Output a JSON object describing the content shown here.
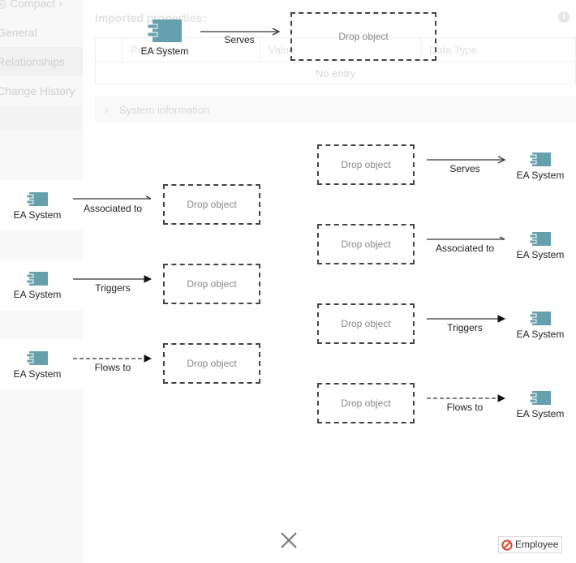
{
  "background": {
    "sidebar": {
      "compact_label": "Compact",
      "items": [
        {
          "label": "General"
        },
        {
          "label": "Relationships"
        },
        {
          "label": "Change History"
        }
      ]
    },
    "imported_properties": {
      "title": "Imported properties:",
      "columns": [
        "Property",
        "Value",
        "Data Type"
      ],
      "empty_text": "No entry"
    },
    "system_information_label": "System information",
    "info_icon": "info-icon"
  },
  "diagram": {
    "top": {
      "source": {
        "label": "EA System",
        "icon": "application-component-icon"
      },
      "relation": "Serves",
      "target": {
        "label": "Drop object"
      }
    },
    "incoming": [
      {
        "source": "Drop object",
        "relation": "Serves",
        "target": "EA System",
        "line": "solid",
        "head": "open"
      },
      {
        "source": "Drop object",
        "relation": "Associated to",
        "target": "EA System",
        "line": "solid",
        "head": "half"
      },
      {
        "source": "Drop object",
        "relation": "Triggers",
        "target": "EA System",
        "line": "solid",
        "head": "filled"
      },
      {
        "source": "Drop object",
        "relation": "Flows to",
        "target": "EA System",
        "line": "dashed",
        "head": "filled"
      }
    ],
    "outgoing": [
      {
        "source": "EA System",
        "relation": "Associated to",
        "target": "Drop object",
        "line": "solid",
        "head": "half"
      },
      {
        "source": "EA System",
        "relation": "Triggers",
        "target": "Drop object",
        "line": "solid",
        "head": "filled"
      },
      {
        "source": "EA System",
        "relation": "Flows to",
        "target": "Drop object",
        "line": "dashed",
        "head": "filled"
      }
    ],
    "component_color": "#66a0ad"
  },
  "footer": {
    "close_icon": "close-icon",
    "badge": {
      "label": "Employee",
      "icon": "prohibited-icon",
      "icon_color": "#d9472b"
    }
  }
}
